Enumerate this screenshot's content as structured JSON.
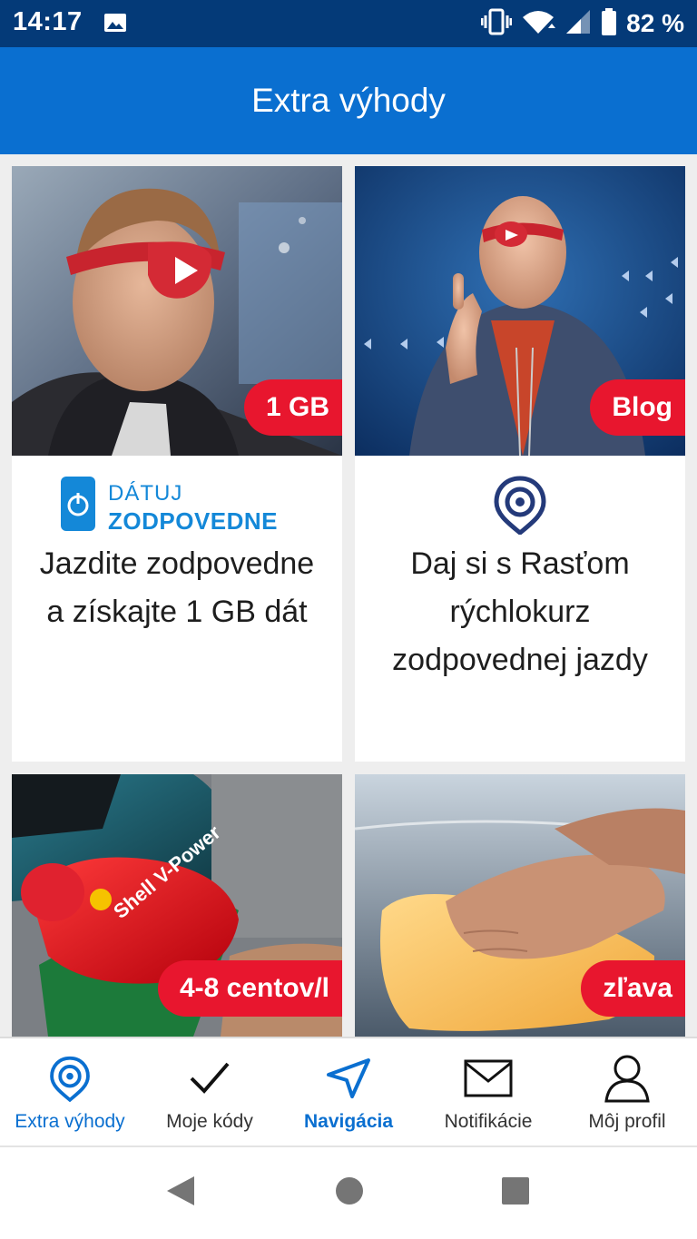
{
  "status": {
    "time": "14:17",
    "battery": "82 %",
    "icons": [
      "image-icon",
      "vibrate-icon",
      "wifi-icon",
      "signal-icon",
      "battery-icon"
    ]
  },
  "header": {
    "title": "Extra výhody"
  },
  "cards": [
    {
      "badge": "1 GB",
      "logo_line1": "DÁTUJ",
      "logo_line2": "ZODPOVEDNE",
      "text": "Jazdite zodpovedne a získajte 1 GB dát"
    },
    {
      "badge": "Blog",
      "logo_icon": "location-target-icon",
      "text": "Daj si s Rasťom rýchlokurz zodpovednej jazdy"
    },
    {
      "badge": "4-8 centov/l",
      "image_brand": "Shell V-Power",
      "text": ""
    },
    {
      "badge": "zľava",
      "text": ""
    }
  ],
  "bottom_nav": {
    "items": [
      {
        "label": "Extra výhody",
        "icon": "location-target-icon",
        "state": "active"
      },
      {
        "label": "Moje kódy",
        "icon": "check-icon",
        "state": "normal"
      },
      {
        "label": "Navigácia",
        "icon": "navigation-arrow-icon",
        "state": "highlight"
      },
      {
        "label": "Notifikácie",
        "icon": "envelope-icon",
        "state": "normal"
      },
      {
        "label": "Môj profil",
        "icon": "user-icon",
        "state": "normal"
      }
    ]
  },
  "colors": {
    "status_bar": "#043a78",
    "header": "#0a6fd0",
    "badge": "#e8162e",
    "background": "#eeeeee"
  }
}
